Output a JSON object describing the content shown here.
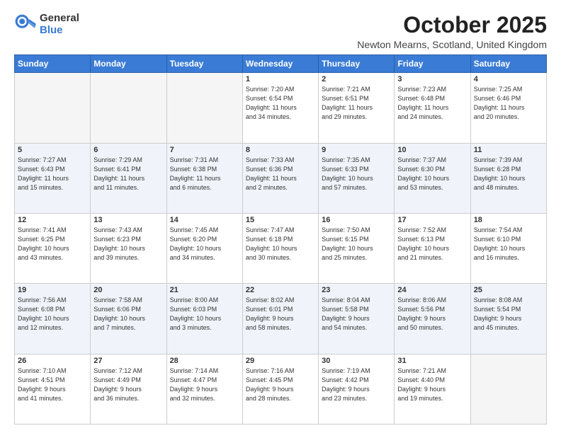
{
  "logo": {
    "general": "General",
    "blue": "Blue"
  },
  "header": {
    "month": "October 2025",
    "location": "Newton Mearns, Scotland, United Kingdom"
  },
  "days_header": [
    "Sunday",
    "Monday",
    "Tuesday",
    "Wednesday",
    "Thursday",
    "Friday",
    "Saturday"
  ],
  "weeks": [
    [
      {
        "day": "",
        "info": ""
      },
      {
        "day": "",
        "info": ""
      },
      {
        "day": "",
        "info": ""
      },
      {
        "day": "1",
        "info": "Sunrise: 7:20 AM\nSunset: 6:54 PM\nDaylight: 11 hours\nand 34 minutes."
      },
      {
        "day": "2",
        "info": "Sunrise: 7:21 AM\nSunset: 6:51 PM\nDaylight: 11 hours\nand 29 minutes."
      },
      {
        "day": "3",
        "info": "Sunrise: 7:23 AM\nSunset: 6:48 PM\nDaylight: 11 hours\nand 24 minutes."
      },
      {
        "day": "4",
        "info": "Sunrise: 7:25 AM\nSunset: 6:46 PM\nDaylight: 11 hours\nand 20 minutes."
      }
    ],
    [
      {
        "day": "5",
        "info": "Sunrise: 7:27 AM\nSunset: 6:43 PM\nDaylight: 11 hours\nand 15 minutes."
      },
      {
        "day": "6",
        "info": "Sunrise: 7:29 AM\nSunset: 6:41 PM\nDaylight: 11 hours\nand 11 minutes."
      },
      {
        "day": "7",
        "info": "Sunrise: 7:31 AM\nSunset: 6:38 PM\nDaylight: 11 hours\nand 6 minutes."
      },
      {
        "day": "8",
        "info": "Sunrise: 7:33 AM\nSunset: 6:36 PM\nDaylight: 11 hours\nand 2 minutes."
      },
      {
        "day": "9",
        "info": "Sunrise: 7:35 AM\nSunset: 6:33 PM\nDaylight: 10 hours\nand 57 minutes."
      },
      {
        "day": "10",
        "info": "Sunrise: 7:37 AM\nSunset: 6:30 PM\nDaylight: 10 hours\nand 53 minutes."
      },
      {
        "day": "11",
        "info": "Sunrise: 7:39 AM\nSunset: 6:28 PM\nDaylight: 10 hours\nand 48 minutes."
      }
    ],
    [
      {
        "day": "12",
        "info": "Sunrise: 7:41 AM\nSunset: 6:25 PM\nDaylight: 10 hours\nand 43 minutes."
      },
      {
        "day": "13",
        "info": "Sunrise: 7:43 AM\nSunset: 6:23 PM\nDaylight: 10 hours\nand 39 minutes."
      },
      {
        "day": "14",
        "info": "Sunrise: 7:45 AM\nSunset: 6:20 PM\nDaylight: 10 hours\nand 34 minutes."
      },
      {
        "day": "15",
        "info": "Sunrise: 7:47 AM\nSunset: 6:18 PM\nDaylight: 10 hours\nand 30 minutes."
      },
      {
        "day": "16",
        "info": "Sunrise: 7:50 AM\nSunset: 6:15 PM\nDaylight: 10 hours\nand 25 minutes."
      },
      {
        "day": "17",
        "info": "Sunrise: 7:52 AM\nSunset: 6:13 PM\nDaylight: 10 hours\nand 21 minutes."
      },
      {
        "day": "18",
        "info": "Sunrise: 7:54 AM\nSunset: 6:10 PM\nDaylight: 10 hours\nand 16 minutes."
      }
    ],
    [
      {
        "day": "19",
        "info": "Sunrise: 7:56 AM\nSunset: 6:08 PM\nDaylight: 10 hours\nand 12 minutes."
      },
      {
        "day": "20",
        "info": "Sunrise: 7:58 AM\nSunset: 6:06 PM\nDaylight: 10 hours\nand 7 minutes."
      },
      {
        "day": "21",
        "info": "Sunrise: 8:00 AM\nSunset: 6:03 PM\nDaylight: 10 hours\nand 3 minutes."
      },
      {
        "day": "22",
        "info": "Sunrise: 8:02 AM\nSunset: 6:01 PM\nDaylight: 9 hours\nand 58 minutes."
      },
      {
        "day": "23",
        "info": "Sunrise: 8:04 AM\nSunset: 5:58 PM\nDaylight: 9 hours\nand 54 minutes."
      },
      {
        "day": "24",
        "info": "Sunrise: 8:06 AM\nSunset: 5:56 PM\nDaylight: 9 hours\nand 50 minutes."
      },
      {
        "day": "25",
        "info": "Sunrise: 8:08 AM\nSunset: 5:54 PM\nDaylight: 9 hours\nand 45 minutes."
      }
    ],
    [
      {
        "day": "26",
        "info": "Sunrise: 7:10 AM\nSunset: 4:51 PM\nDaylight: 9 hours\nand 41 minutes."
      },
      {
        "day": "27",
        "info": "Sunrise: 7:12 AM\nSunset: 4:49 PM\nDaylight: 9 hours\nand 36 minutes."
      },
      {
        "day": "28",
        "info": "Sunrise: 7:14 AM\nSunset: 4:47 PM\nDaylight: 9 hours\nand 32 minutes."
      },
      {
        "day": "29",
        "info": "Sunrise: 7:16 AM\nSunset: 4:45 PM\nDaylight: 9 hours\nand 28 minutes."
      },
      {
        "day": "30",
        "info": "Sunrise: 7:19 AM\nSunset: 4:42 PM\nDaylight: 9 hours\nand 23 minutes."
      },
      {
        "day": "31",
        "info": "Sunrise: 7:21 AM\nSunset: 4:40 PM\nDaylight: 9 hours\nand 19 minutes."
      },
      {
        "day": "",
        "info": ""
      }
    ]
  ]
}
